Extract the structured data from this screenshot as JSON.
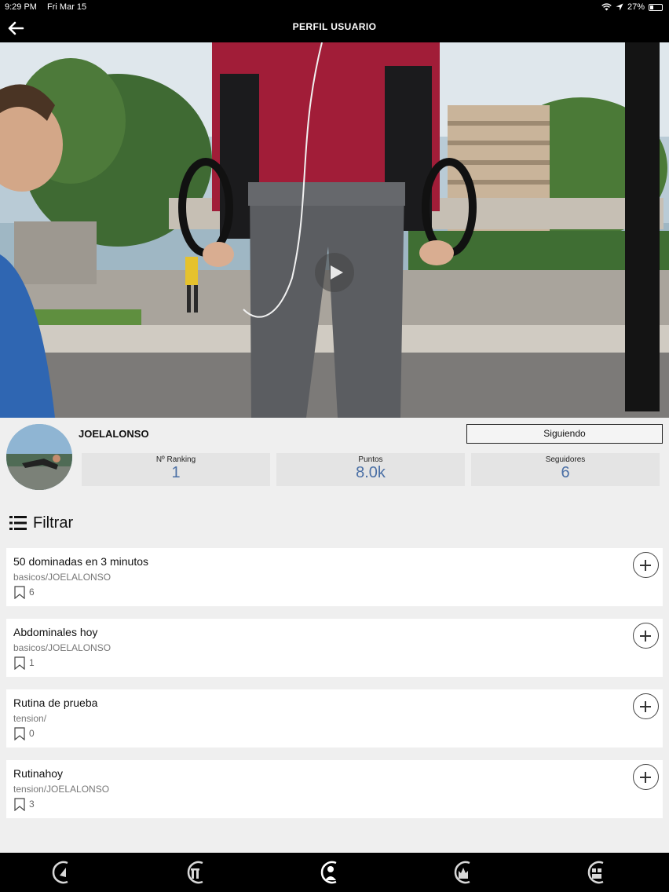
{
  "status_bar": {
    "time": "9:29 PM",
    "date": "Fri Mar 15",
    "battery": "27%",
    "battery_level": 0.27
  },
  "nav": {
    "title": "PERFIL USUARIO"
  },
  "profile": {
    "username": "JOELALONSO",
    "follow_label": "Siguiendo",
    "stats": [
      {
        "label": "Nº Ranking",
        "value": "1"
      },
      {
        "label": "Puntos",
        "value": "8.0k"
      },
      {
        "label": "Seguidores",
        "value": "6"
      }
    ]
  },
  "filter": {
    "label": "Filtrar"
  },
  "routines": [
    {
      "title": "50 dominadas en 3 minutos",
      "path": "basicos/JOELALONSO",
      "saves": "6"
    },
    {
      "title": "Abdominales hoy",
      "path": "basicos/JOELALONSO",
      "saves": "1"
    },
    {
      "title": "Rutina de prueba",
      "path": "tension/",
      "saves": "0"
    },
    {
      "title": "Rutinahoy",
      "path": "tension/JOELALONSO",
      "saves": "3"
    }
  ],
  "tabs": [
    {
      "icon": "home-icon"
    },
    {
      "icon": "routines-icon"
    },
    {
      "icon": "profile-icon",
      "active": true
    },
    {
      "icon": "ranking-icon"
    },
    {
      "icon": "store-icon"
    }
  ],
  "colors": {
    "accent": "#4a6fa5",
    "bar": "#000000",
    "background": "#efefef"
  }
}
